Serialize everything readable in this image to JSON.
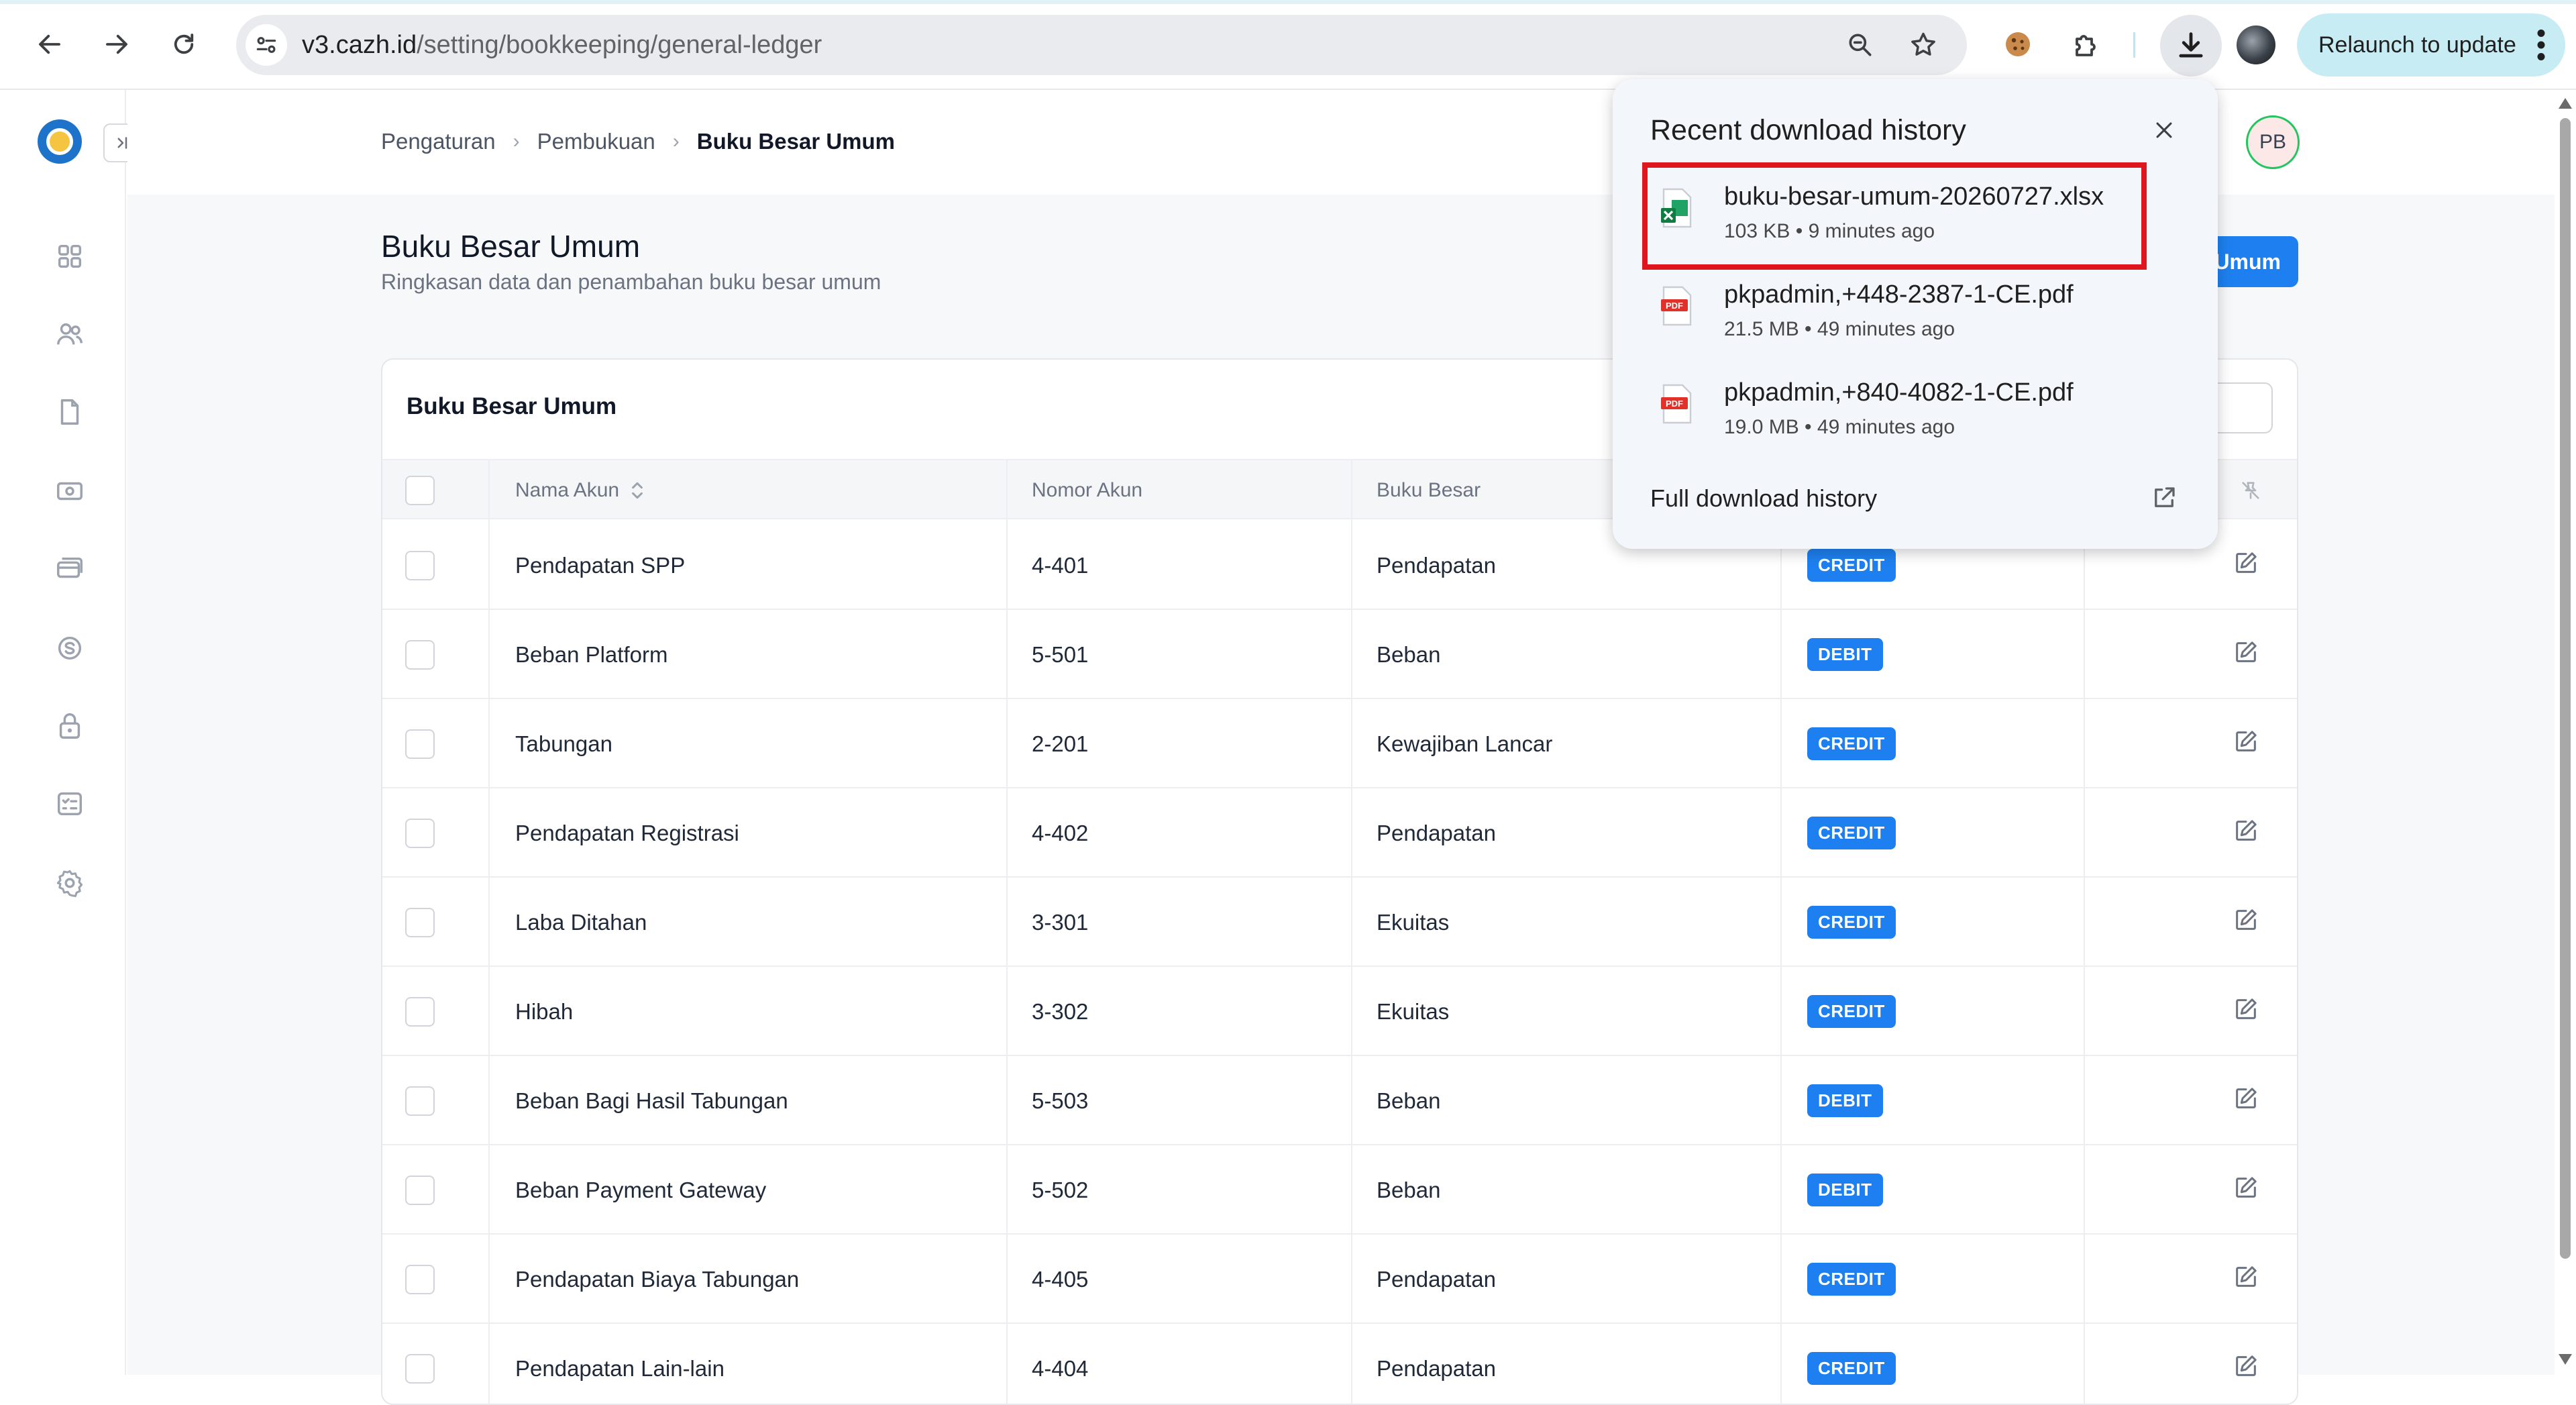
{
  "browser": {
    "url_host": "v3.cazh.id",
    "url_path": "/setting/bookkeeping/general-ledger",
    "relaunch_label": "Relaunch to update"
  },
  "breadcrumb": [
    "Pengaturan",
    "Pembukuan",
    "Buku Besar Umum"
  ],
  "avatar_initials": "PB",
  "page": {
    "title": "Buku Besar Umum",
    "subtitle": "Ringkasan data dan penambahan buku besar umum",
    "add_button_label": "Umum"
  },
  "table": {
    "card_title": "Buku Besar Umum",
    "columns": [
      "Nama Akun",
      "Nomor Akun",
      "Buku Besar"
    ],
    "rows": [
      {
        "name": "Pendapatan SPP",
        "number": "4-401",
        "ledger": "Pendapatan",
        "type": "CREDIT"
      },
      {
        "name": "Beban Platform",
        "number": "5-501",
        "ledger": "Beban",
        "type": "DEBIT"
      },
      {
        "name": "Tabungan",
        "number": "2-201",
        "ledger": "Kewajiban Lancar",
        "type": "CREDIT"
      },
      {
        "name": "Pendapatan Registrasi",
        "number": "4-402",
        "ledger": "Pendapatan",
        "type": "CREDIT"
      },
      {
        "name": "Laba Ditahan",
        "number": "3-301",
        "ledger": "Ekuitas",
        "type": "CREDIT"
      },
      {
        "name": "Hibah",
        "number": "3-302",
        "ledger": "Ekuitas",
        "type": "CREDIT"
      },
      {
        "name": "Beban Bagi Hasil Tabungan",
        "number": "5-503",
        "ledger": "Beban",
        "type": "DEBIT"
      },
      {
        "name": "Beban Payment Gateway",
        "number": "5-502",
        "ledger": "Beban",
        "type": "DEBIT"
      },
      {
        "name": "Pendapatan Biaya Tabungan",
        "number": "4-405",
        "ledger": "Pendapatan",
        "type": "CREDIT"
      },
      {
        "name": "Pendapatan Lain-lain",
        "number": "4-404",
        "ledger": "Pendapatan",
        "type": "CREDIT"
      }
    ]
  },
  "downloads": {
    "title": "Recent download history",
    "items": [
      {
        "name": "buku-besar-umum-20260727.xlsx",
        "meta": "103 KB • 9 minutes ago",
        "icon": "excel-file-icon"
      },
      {
        "name": "pkpadmin,+448-2387-1-CE.pdf",
        "meta": "21.5 MB • 49 minutes ago",
        "icon": "pdf-file-icon"
      },
      {
        "name": "pkpadmin,+840-4082-1-CE.pdf",
        "meta": "19.0 MB • 49 minutes ago",
        "icon": "pdf-file-icon"
      }
    ],
    "full_history_label": "Full download history"
  },
  "colors": {
    "accent": "#1e80f0",
    "highlight": "#e0161e",
    "relaunch_bg": "#c8ecf4"
  }
}
